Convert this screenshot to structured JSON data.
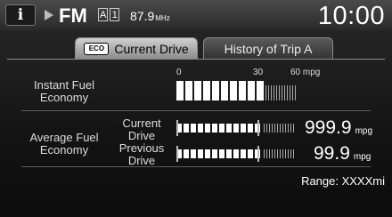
{
  "status_bar": {
    "info_icon": "i",
    "band": "FM",
    "preset_badges": [
      "A",
      "1"
    ],
    "frequency": "87.9",
    "frequency_unit": "MHz",
    "clock": "10:00"
  },
  "tabs": [
    {
      "label": "Current Drive",
      "icon_text": "ECO",
      "active": true
    },
    {
      "label": "History of Trip A",
      "active": false
    }
  ],
  "scale": {
    "min": "0",
    "mid": "30",
    "max": "60 mpg"
  },
  "instant": {
    "label_line1": "Instant Fuel",
    "label_line2": "Economy"
  },
  "average": {
    "label_line1": "Average Fuel",
    "label_line2": "Economy",
    "current_line1": "Current",
    "current_line2": "Drive",
    "current_value": "999.9",
    "previous_line1": "Previous",
    "previous_line2": "Drive",
    "previous_value": "99.9",
    "unit": "mpg"
  },
  "range": "Range: XXXXmi"
}
